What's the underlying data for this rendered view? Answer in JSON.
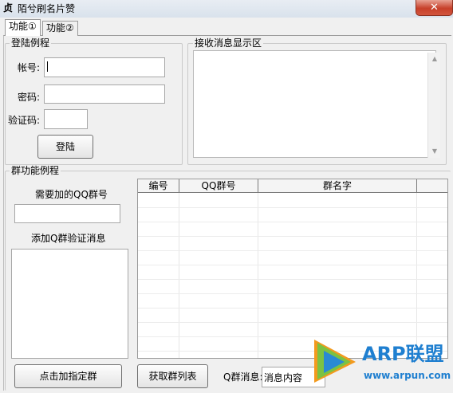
{
  "window": {
    "title": "陌兮刷名片赞",
    "close_glyph": "✕",
    "icon_glyph": "贞"
  },
  "tabs": [
    {
      "label": "功能①",
      "active": true
    },
    {
      "label": "功能②",
      "active": false
    }
  ],
  "login_group": {
    "legend": "登陆例程",
    "account_label": "帐号:",
    "account_value": "",
    "password_label": "密码:",
    "password_value": "",
    "captcha_label": "验证码:",
    "captcha_value": "",
    "login_button": "登陆"
  },
  "message_group": {
    "legend": "接收消息显示区",
    "content": ""
  },
  "qq_group": {
    "legend": "群功能例程",
    "group_number_label": "需要加的QQ群号",
    "group_number_value": "",
    "verify_message_label": "添加Q群验证消息",
    "verify_message_value": "",
    "add_group_button": "点击加指定群",
    "fetch_list_button": "获取群列表",
    "group_message_label": "Q群消息:",
    "group_message_value": "消息内容"
  },
  "group_table": {
    "columns": [
      "编号",
      "QQ群号",
      "群名字",
      ""
    ],
    "rows": []
  },
  "watermark": {
    "brand": "ARP联盟",
    "url": "www.arpun.com",
    "colors": {
      "brand": "#1f7fd0",
      "play_green": "#7cc242",
      "play_blue": "#2a8ad4",
      "play_orange": "#f39a1e"
    }
  },
  "colors": {
    "window_bg": "#f0f0f0",
    "close_button": "#c7402a",
    "field_bg": "#ffffff"
  }
}
